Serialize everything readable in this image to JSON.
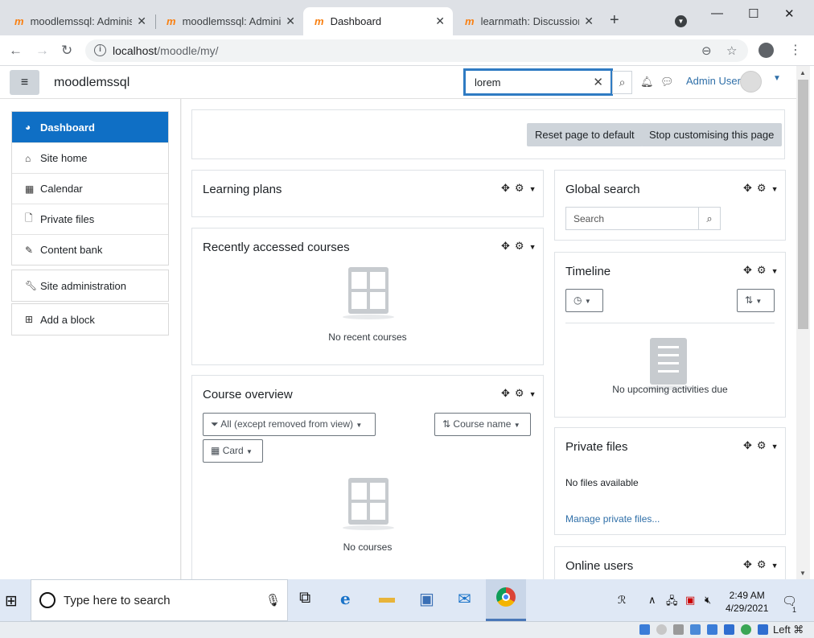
{
  "browser": {
    "tabs": [
      {
        "favicon": "m",
        "title": "moodlemssql: Adminis",
        "close": "✕"
      },
      {
        "favicon": "m",
        "title": "moodlemssql: Adminis",
        "close": "✕"
      },
      {
        "favicon": "m",
        "title": "Dashboard",
        "close": "✕",
        "active": true
      },
      {
        "favicon": "m",
        "title": "learnmath: Discussion",
        "close": "✕"
      }
    ],
    "url_host": "localhost",
    "url_path": "/moodle/my/"
  },
  "navbar": {
    "site_name": "moodlemssql",
    "search_value": "lorem",
    "user_name": "Admin User"
  },
  "drawer": {
    "main_items": [
      {
        "label": "Dashboard",
        "icon": "dashboard-icon",
        "active": true
      },
      {
        "label": "Site home",
        "icon": "home-icon"
      },
      {
        "label": "Calendar",
        "icon": "calendar-icon"
      },
      {
        "label": "Private files",
        "icon": "file-icon"
      },
      {
        "label": "Content bank",
        "icon": "paint-brush-icon"
      }
    ],
    "admin_item": {
      "label": "Site administration",
      "icon": "wrench-icon"
    },
    "add_block_item": {
      "label": "Add a block",
      "icon": "plus-square-icon"
    }
  },
  "page_actions": {
    "reset_label": "Reset page to default",
    "stop_label": "Stop customising this page"
  },
  "blocks": {
    "learning_plans": {
      "title": "Learning plans"
    },
    "recent_courses": {
      "title": "Recently accessed courses",
      "empty": "No recent courses"
    },
    "course_overview": {
      "title": "Course overview",
      "filter_label": "All (except removed from view)",
      "sort_label": "Course name",
      "view_label": "Card",
      "empty": "No courses"
    },
    "global_search": {
      "title": "Global search",
      "placeholder": "Search"
    },
    "timeline": {
      "title": "Timeline",
      "empty": "No upcoming activities due"
    },
    "private_files": {
      "title": "Private files",
      "empty": "No files available",
      "manage_link": "Manage private files..."
    },
    "online_users": {
      "title": "Online users"
    }
  },
  "taskbar": {
    "search_placeholder": "Type here to search",
    "time": "2:49 AM",
    "date": "4/29/2021",
    "notification_count": "1"
  },
  "statusbar": {
    "keyboard_label": "Left ⌘"
  }
}
